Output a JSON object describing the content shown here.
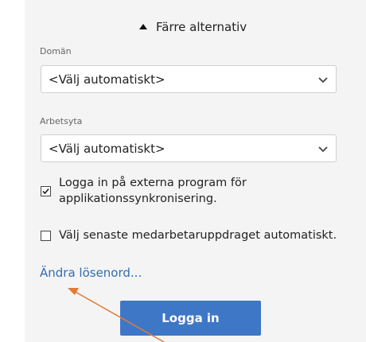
{
  "options_toggle": {
    "label": "Färre alternativ",
    "icon": "chevron-up-icon"
  },
  "domain": {
    "label": "Domän",
    "value": "<Välj automatiskt>"
  },
  "workspace": {
    "label": "Arbetsyta",
    "value": "<Välj automatiskt>"
  },
  "external_login": {
    "label": "Logga in på externa program för applikationssynkronisering.",
    "checked": true
  },
  "auto_assignment": {
    "label": "Välj senaste medarbetaruppdraget automatiskt.",
    "checked": false
  },
  "change_password_link": "Ändra lösenord...",
  "login_button": "Logga in",
  "colors": {
    "accent": "#3f77c7",
    "link": "#2f6db5",
    "annotation_arrow": "#e07b39"
  }
}
